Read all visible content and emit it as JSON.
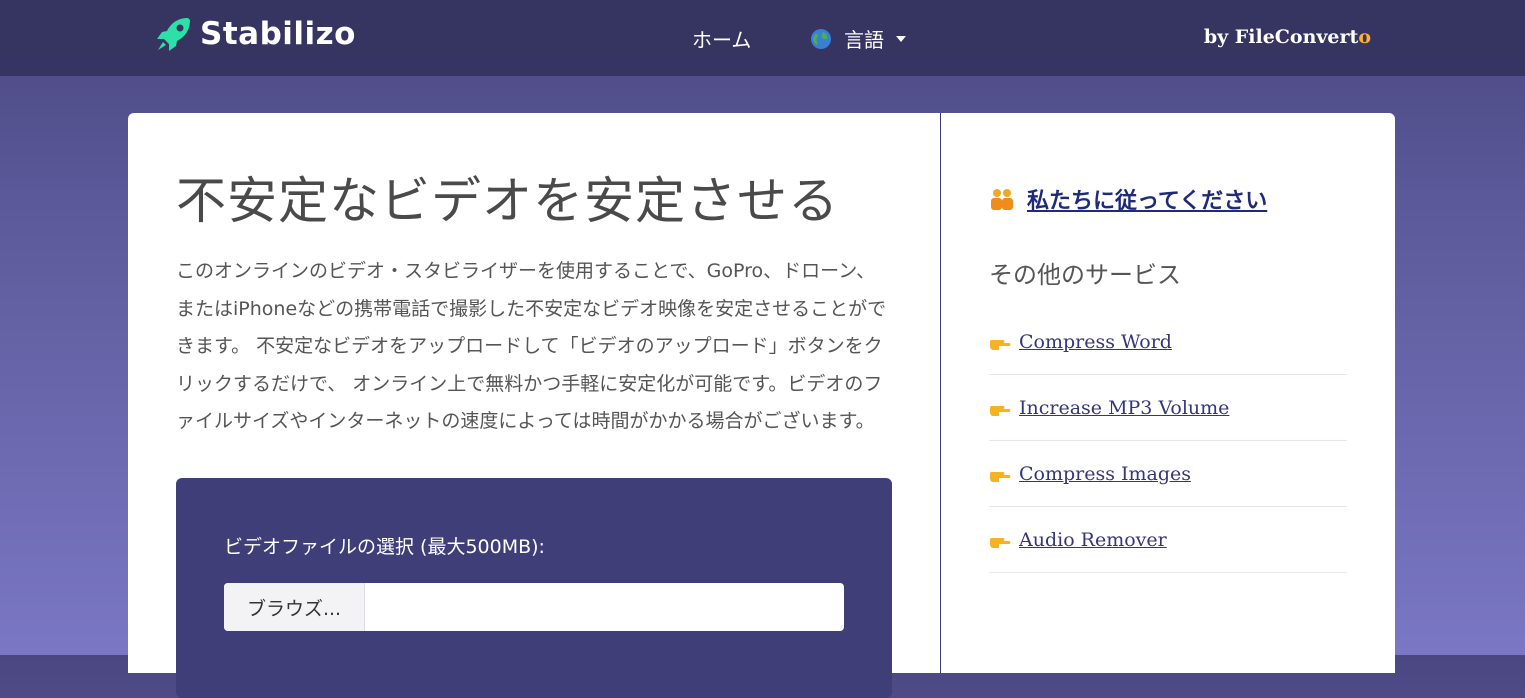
{
  "header": {
    "brand": "Stabilizo",
    "nav_home": "ホーム",
    "nav_language": "言語",
    "byline_prefix": "by FileConvert",
    "byline_accent": "o"
  },
  "main": {
    "title": "不安定なビデオを安定させる",
    "description": "このオンラインのビデオ・スタビライザーを使用することで、GoPro、ドローン、またはiPhoneなどの携帯電話で撮影した不安定なビデオ映像を安定させることができます。 不安定なビデオをアップロードして「ビデオのアップロード」ボタンをクリックするだけで、 オンライン上で無料かつ手軽に安定化が可能です。ビデオのファイルサイズやインターネットの速度によっては時間がかかる場合がございます。",
    "upload": {
      "label": "ビデオファイルの選択 (最大500MB):",
      "browse_label": "ブラウズ...",
      "file_value": ""
    }
  },
  "sidebar": {
    "follow_text": "私たちに従ってください",
    "other_services_heading": "その他のサービス",
    "services": [
      {
        "label": "Compress Word",
        "icon": "pointing-hand-icon"
      },
      {
        "label": "Increase MP3 Volume",
        "icon": "pointing-hand-icon"
      },
      {
        "label": "Compress Images",
        "icon": "pointing-hand-icon"
      },
      {
        "label": "Audio Remover",
        "icon": "pointing-hand-icon"
      }
    ]
  },
  "colors": {
    "navbar": "#363461",
    "background_top": "#4a4782",
    "background_bottom": "#7a77c4",
    "upload_panel": "#403e79",
    "brand_icon": "#2de0a5",
    "byline_accent": "#ffb12b",
    "link": "#35357a"
  }
}
